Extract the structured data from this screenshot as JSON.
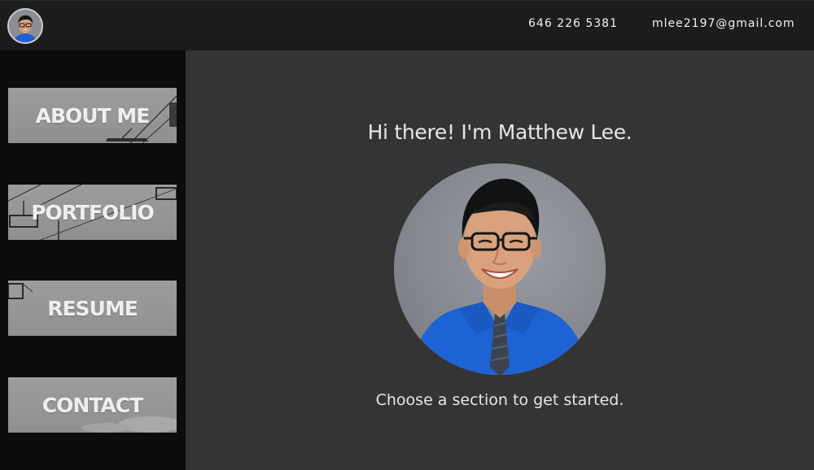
{
  "header": {
    "avatar_icon": "profile-avatar-icon",
    "phone": "646 226 5381",
    "email": "mlee2197@gmail.com"
  },
  "sidebar": {
    "items": [
      {
        "label": "ABOUT ME"
      },
      {
        "label": "PORTFOLIO"
      },
      {
        "label": "RESUME"
      },
      {
        "label": "CONTACT"
      }
    ]
  },
  "main": {
    "greeting": "Hi there! I'm Matthew Lee.",
    "portrait_icon": "portrait-photo",
    "call_to_action": "Choose a section to get started."
  },
  "colors": {
    "page_bg": "#343434",
    "header_bg": "#1c1c1c",
    "sidebar_bg": "#0c0c0c",
    "tile_bg": "#979797",
    "text": "#e6e6e6",
    "shirt_blue": "#1e63d4"
  }
}
